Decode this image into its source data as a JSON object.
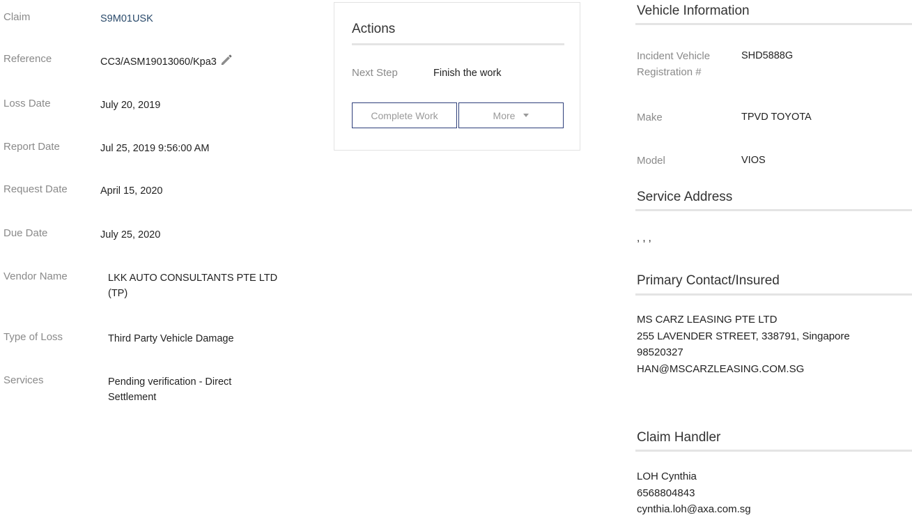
{
  "details": {
    "claim": {
      "label": "Claim",
      "value": "S9M01USK"
    },
    "reference": {
      "label": "Reference",
      "value": "CC3/ASM19013060/Kpa3"
    },
    "loss_date": {
      "label": "Loss Date",
      "value": "July 20, 2019"
    },
    "report_date": {
      "label": "Report Date",
      "value": "Jul 25, 2019 9:56:00 AM"
    },
    "request_date": {
      "label": "Request Date",
      "value": "April 15, 2020"
    },
    "due_date": {
      "label": "Due Date",
      "value": "July 25, 2020"
    },
    "vendor_name": {
      "label": "Vendor Name",
      "value": "LKK AUTO CONSULTANTS PTE LTD (TP)"
    },
    "type_of_loss": {
      "label": "Type of Loss",
      "value": "Third Party Vehicle Damage"
    },
    "services": {
      "label": "Services",
      "value": "Pending verification - Direct Settlement"
    }
  },
  "actions": {
    "title": "Actions",
    "next_step_label": "Next Step",
    "next_step_value": "Finish the work",
    "complete_button": "Complete Work",
    "more_button": "More"
  },
  "vehicle": {
    "title": "Vehicle Information",
    "registration_label": "Incident Vehicle Registration #",
    "registration_value": "SHD5888G",
    "make_label": "Make",
    "make_value": "TPVD TOYOTA",
    "model_label": "Model",
    "model_value": "VIOS"
  },
  "service_address": {
    "title": "Service Address",
    "value": ", , ,"
  },
  "primary_contact": {
    "title": "Primary Contact/Insured",
    "name": "MS CARZ LEASING PTE LTD",
    "address": "255 LAVENDER STREET, 338791, Singapore",
    "phone": "98520327",
    "email": "HAN@MSCARZLEASING.COM.SG"
  },
  "claim_handler": {
    "title": "Claim Handler",
    "name": "LOH Cynthia",
    "phone": "6568804843",
    "email": "cynthia.loh@axa.com.sg"
  }
}
